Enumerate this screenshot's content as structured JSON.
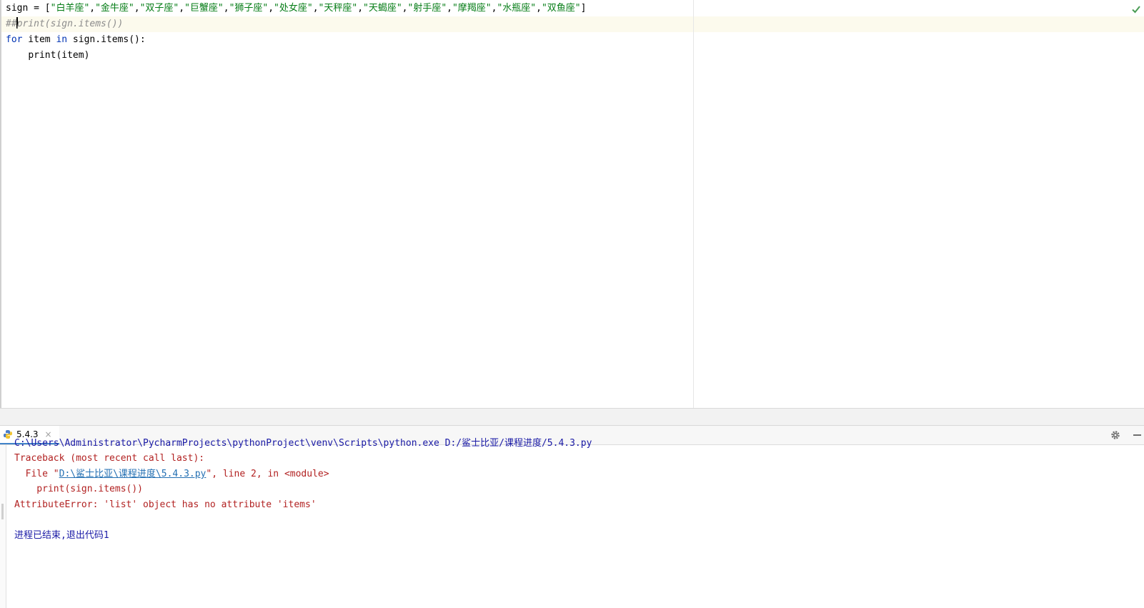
{
  "editor": {
    "line1": {
      "prefix": "sign = [",
      "strings": [
        "\"白羊座\"",
        "\"金牛座\"",
        "\"双子座\"",
        "\"巨蟹座\"",
        "\"狮子座\"",
        "\"处女座\"",
        "\"天秤座\"",
        "\"天蝎座\"",
        "\"射手座\"",
        "\"摩羯座\"",
        "\"水瓶座\"",
        "\"双鱼座\""
      ],
      "separator": ",",
      "suffix": "]"
    },
    "line2": {
      "hash": "##",
      "comment": "print(sign.items())"
    },
    "line3": {
      "kw_for": "for",
      "var": " item ",
      "kw_in": "in",
      "rest": " sign.items():"
    },
    "line4": {
      "indent": "    ",
      "text": "print(item)"
    },
    "status_icon": "check-icon"
  },
  "run_tool": {
    "tab_label": "5.4.3",
    "tab_close": "×",
    "icons": [
      "python-icon",
      "gear-icon",
      "minimize-icon"
    ]
  },
  "console": {
    "command": "C:\\Users\\Administrator\\PycharmProjects\\pythonProject\\venv\\Scripts\\python.exe D:/鲨士比亚/课程进度/5.4.3.py",
    "traceback_header": "Traceback (most recent call last):",
    "file_prefix": "  File \"",
    "file_link": "D:\\鲨士比亚\\课程进度\\5.4.3.py",
    "file_suffix": "\", line 2, in <module>",
    "code_line": "    print(sign.items())",
    "error": "AttributeError: 'list' object has no attribute 'items'",
    "exit_message": "进程已结束,退出代码1"
  },
  "colors": {
    "keyword": "#0033b3",
    "string": "#067d17",
    "comment": "#8c8c8c",
    "error": "#b22222",
    "link": "#2470b3",
    "current_line": "#fcfaed"
  }
}
